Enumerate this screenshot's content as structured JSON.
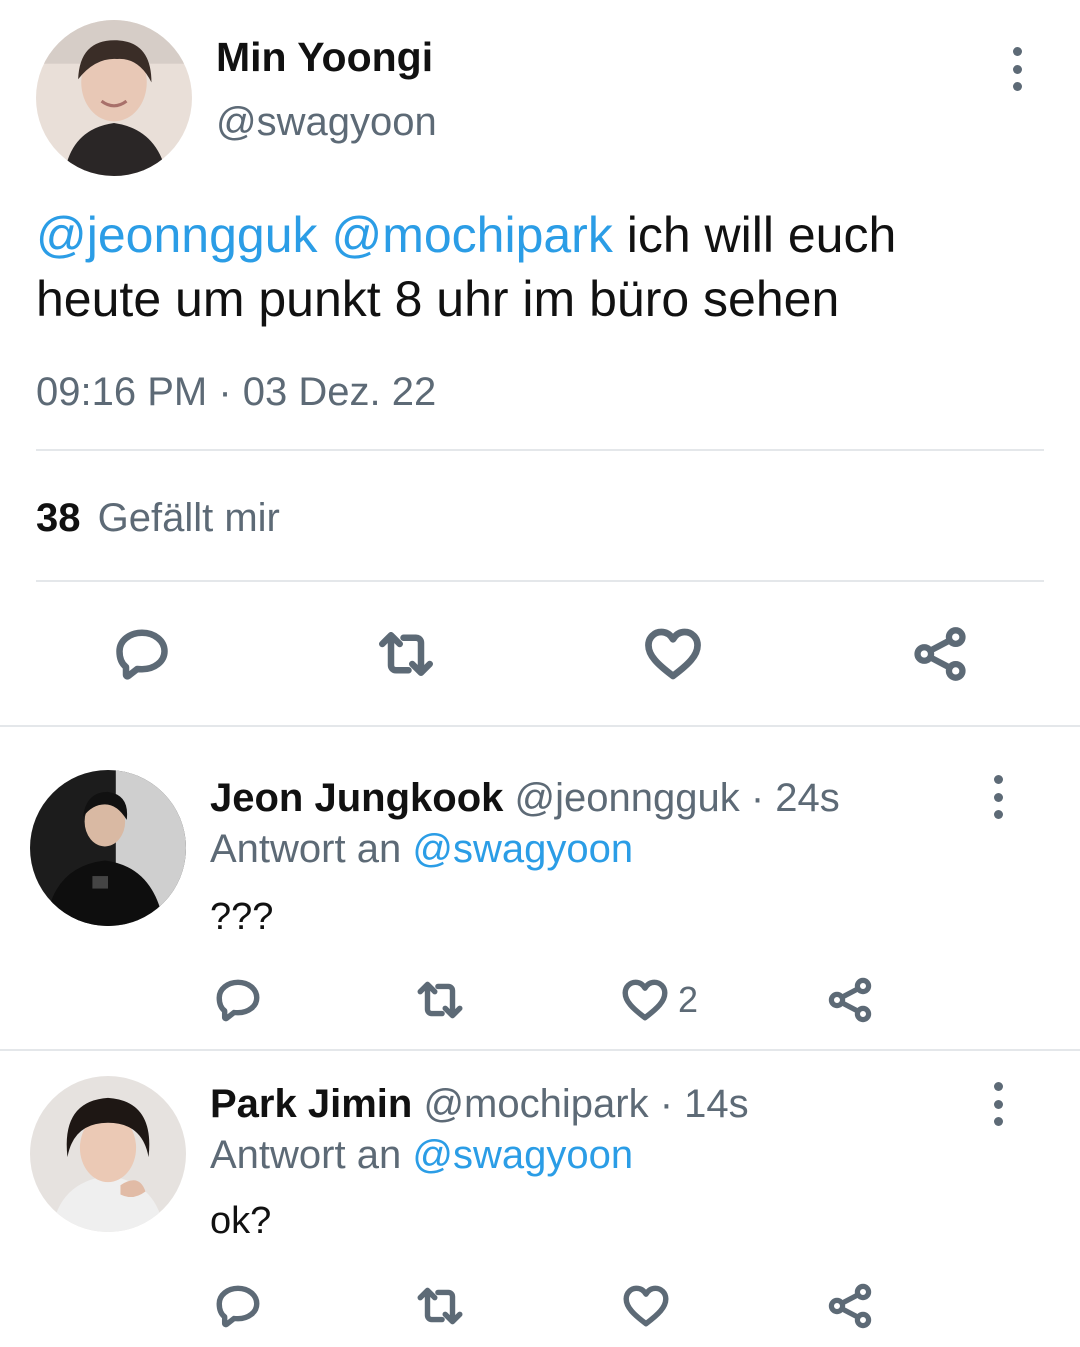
{
  "main_tweet": {
    "author_name": "Min Yoongi",
    "author_handle": "@swagyoon",
    "mention_1": "@jeonngguk",
    "mention_2": "@mochipark",
    "text_after_mentions": " ich will euch",
    "text_line_2": "heute um punkt 8 uhr im büro sehen",
    "timestamp": "09:16 PM · 03 Dez. 22",
    "likes_count": "38",
    "likes_label": "Gefällt mir"
  },
  "replies": [
    {
      "author_name": "Jeon Jungkook",
      "author_handle": "@jeonngguk",
      "age": "· 24s",
      "reply_to_label": "Antwort an",
      "reply_to_handle": "@swagyoon",
      "text": "???",
      "like_count": "2"
    },
    {
      "author_name": "Park Jimin",
      "author_handle": "@mochipark",
      "age": "· 14s",
      "reply_to_label": "Antwort an",
      "reply_to_handle": "@swagyoon",
      "text": "ok?",
      "like_count": ""
    }
  ],
  "icons": {
    "reply": "reply-icon",
    "retweet": "retweet-icon",
    "like": "heart-icon",
    "share": "share-icon",
    "more": "more-vertical-icon"
  },
  "colors": {
    "link": "#2b9de6",
    "muted": "#5d6a76",
    "divider": "#e4e7ea"
  }
}
